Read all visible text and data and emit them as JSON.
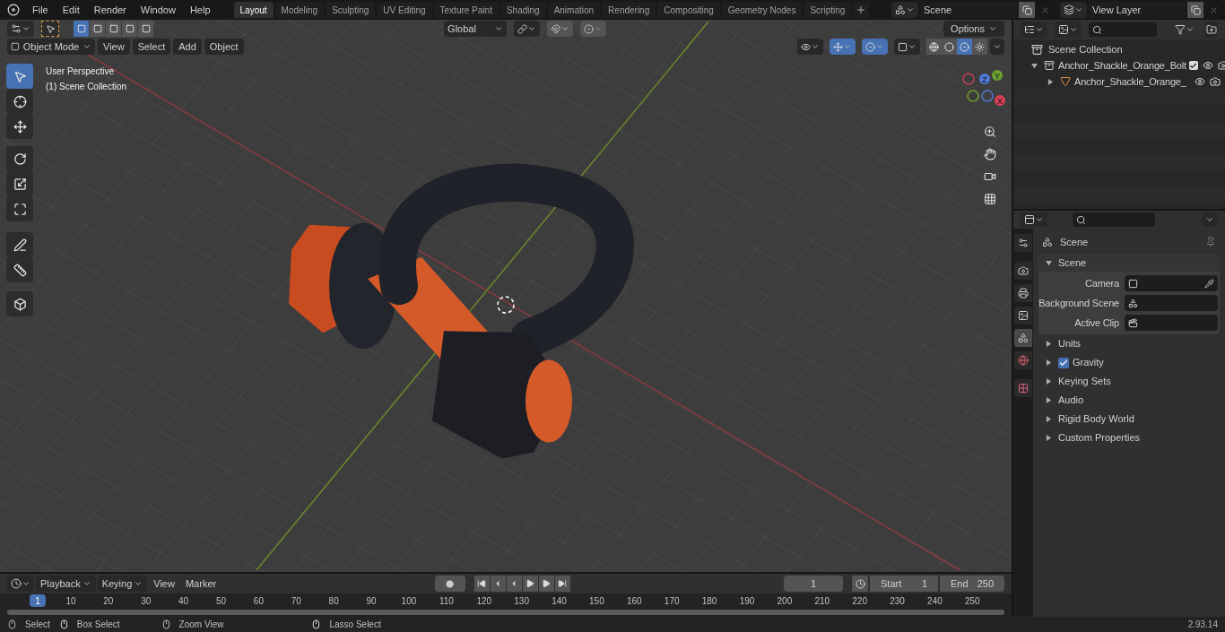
{
  "top_bar": {
    "menus": [
      "File",
      "Edit",
      "Render",
      "Window",
      "Help"
    ],
    "workspaces": [
      {
        "label": "Layout",
        "selected": true
      },
      {
        "label": "Modeling",
        "selected": false
      },
      {
        "label": "Sculpting",
        "selected": false
      },
      {
        "label": "UV Editing",
        "selected": false
      },
      {
        "label": "Texture Paint",
        "selected": false
      },
      {
        "label": "Shading",
        "selected": false
      },
      {
        "label": "Animation",
        "selected": false
      },
      {
        "label": "Rendering",
        "selected": false
      },
      {
        "label": "Compositing",
        "selected": false
      },
      {
        "label": "Geometry Nodes",
        "selected": false
      },
      {
        "label": "Scripting",
        "selected": false
      }
    ],
    "scene": "Scene",
    "view_layer": "View Layer"
  },
  "viewport": {
    "select_modes": [
      {
        "selected": true
      },
      {
        "selected": false
      },
      {
        "selected": false
      },
      {
        "selected": false
      },
      {
        "selected": false
      }
    ],
    "transform_orientation": "Global",
    "options": "Options",
    "mode": "Object Mode",
    "menus": [
      "View",
      "Select",
      "Add",
      "Object"
    ],
    "toggles": [
      {
        "kind": "visibility",
        "selected": false
      },
      {
        "kind": "gizmo",
        "selected": true
      },
      {
        "kind": "overlay",
        "selected": true
      },
      {
        "kind": "xray",
        "selected": false
      }
    ],
    "shading_modes": [
      {
        "kind": "wireframe",
        "selected": false
      },
      {
        "kind": "solid",
        "selected": false
      },
      {
        "kind": "material",
        "selected": true
      },
      {
        "kind": "rendered",
        "selected": false
      }
    ],
    "overlay_text": [
      "User Perspective",
      "(1) Scene Collection"
    ],
    "tools": [
      {
        "kind": "select",
        "selected": true
      },
      {
        "kind": "cursor",
        "selected": false
      },
      {
        "kind": "move",
        "selected": false
      },
      {
        "kind": "rotate",
        "selected": false
      },
      {
        "kind": "scale",
        "selected": false
      },
      {
        "kind": "transform",
        "selected": false
      },
      {
        "kind": "annotate",
        "selected": false
      },
      {
        "kind": "measure",
        "selected": false
      },
      {
        "kind": "add_cube",
        "selected": false
      }
    ],
    "gizmo_axes": [
      "Z",
      "Y",
      "X"
    ]
  },
  "outliner": {
    "root": "Scene Collection",
    "items": [
      {
        "name": "Anchor_Shackle_Orange_Bolt",
        "expanded": true,
        "checked": true,
        "children": [
          {
            "name": "Anchor_Shackle_Orange_",
            "expanded": false
          }
        ]
      }
    ]
  },
  "properties": {
    "tabs": [
      {
        "kind": "tool",
        "selected": false
      },
      {
        "kind": "render",
        "selected": false
      },
      {
        "kind": "output",
        "selected": false
      },
      {
        "kind": "view_layer",
        "selected": false
      },
      {
        "kind": "scene",
        "selected": true
      },
      {
        "kind": "world",
        "selected": false
      },
      {
        "kind": "texture",
        "selected": false
      }
    ],
    "context": "Scene",
    "panel": {
      "title": "Scene",
      "expanded": true
    },
    "fields": [
      {
        "label": "Camera",
        "kind": "object"
      },
      {
        "label": "Background Scene",
        "kind": "scene"
      },
      {
        "label": "Active Clip",
        "kind": "clip"
      }
    ],
    "sections": [
      {
        "label": "Units",
        "kind": "plain",
        "expanded": false
      },
      {
        "label": "Gravity",
        "kind": "checkbox",
        "checked": true,
        "expanded": false
      },
      {
        "label": "Keying Sets",
        "kind": "plain",
        "expanded": false
      },
      {
        "label": "Audio",
        "kind": "plain",
        "expanded": false
      },
      {
        "label": "Rigid Body World",
        "kind": "plain",
        "expanded": false
      },
      {
        "label": "Custom Properties",
        "kind": "plain",
        "expanded": false
      }
    ]
  },
  "timeline": {
    "menus": [
      "Playback",
      "Keying",
      "View",
      "Marker"
    ],
    "current_frame": "1",
    "start_label": "Start",
    "start": "1",
    "end_label": "End",
    "end": "250",
    "playhead": "1",
    "ruler": [
      "10",
      "20",
      "30",
      "40",
      "50",
      "60",
      "70",
      "80",
      "90",
      "100",
      "110",
      "120",
      "130",
      "140",
      "150",
      "160",
      "170",
      "180",
      "190",
      "200",
      "210",
      "220",
      "230",
      "240",
      "250"
    ]
  },
  "status_bar": {
    "hints": [
      {
        "label": "Select",
        "kind": "left"
      },
      {
        "label": "Box Select",
        "kind": "drag"
      },
      {
        "label": "Zoom View",
        "kind": "middle"
      },
      {
        "label": "Lasso Select",
        "kind": "drag"
      }
    ],
    "version": "2.93.14"
  }
}
